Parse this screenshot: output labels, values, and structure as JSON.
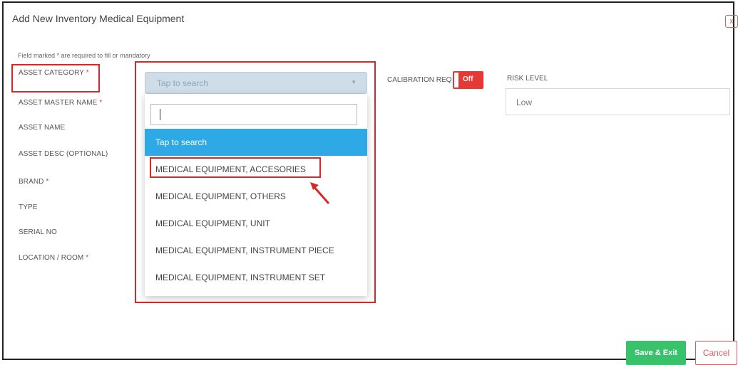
{
  "modal": {
    "title": "Add New Inventory Medical Equipment",
    "close_label": "x",
    "required_note_prefix": "Field marked ",
    "required_star": "*",
    "required_note_suffix": " are required to fill or mandatory"
  },
  "form": {
    "labels": [
      {
        "text": "ASSET CATEGORY",
        "required": "*"
      },
      {
        "text": "ASSET MASTER NAME",
        "required": "*"
      },
      {
        "text": "ASSET NAME",
        "required": ""
      },
      {
        "text": "ASSET DESC (OPTIONAL)",
        "required": ""
      },
      {
        "text": "BRAND",
        "required": "*"
      },
      {
        "text": "TYPE",
        "required": ""
      },
      {
        "text": "SERIAL NO",
        "required": ""
      },
      {
        "text": "LOCATION / ROOM",
        "required": "*"
      }
    ],
    "asset_category": {
      "placeholder": "Tap to search",
      "caret": "▼"
    },
    "dropdown": {
      "search_value": "",
      "options": [
        "Tap to search",
        "MEDICAL EQUIPMENT, ACCESORIES",
        "MEDICAL EQUIPMENT, OTHERS",
        "MEDICAL EQUIPMENT, UNIT",
        "MEDICAL EQUIPMENT, INSTRUMENT PIECE",
        "MEDICAL EQUIPMENT, INSTRUMENT SET"
      ],
      "active_index": 0
    },
    "calibration": {
      "label": "CALIBRATION REQ",
      "state": "Off"
    },
    "risk_level": {
      "label": "RISK LEVEL",
      "value": "Low"
    }
  },
  "actions": {
    "save_label": "Save & Exit",
    "cancel_label": "Cancel"
  },
  "colors": {
    "highlight": "#d62828",
    "active_option": "#2fa8e6",
    "toggle_off": "#e53935",
    "save": "#39c16b"
  }
}
